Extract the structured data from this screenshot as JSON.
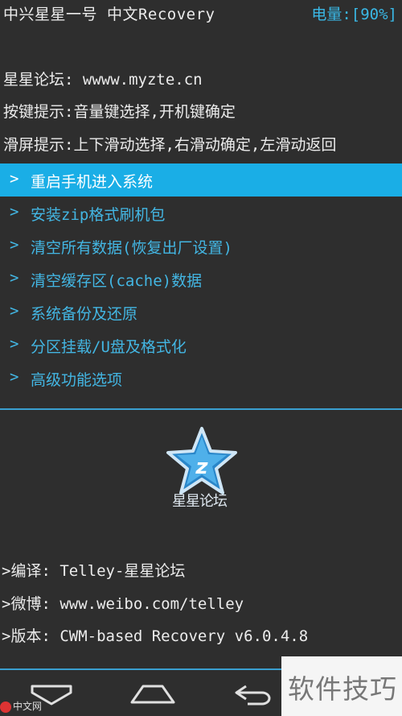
{
  "header": {
    "title": "中兴星星一号 中文Recovery",
    "battery": "电量:[90%]"
  },
  "info": {
    "forum": "星星论坛: wwww.myzte.cn",
    "key_hint": "按键提示:音量键选择,开机键确定",
    "swipe_hint": "滑屏提示:上下滑动选择,右滑动确定,左滑动返回"
  },
  "menu": {
    "arrow": ">",
    "items": [
      {
        "label": "重启手机进入系统",
        "selected": true
      },
      {
        "label": "安装zip格式刷机包",
        "selected": false
      },
      {
        "label": "清空所有数据(恢复出厂设置)",
        "selected": false
      },
      {
        "label": "清空缓存区(cache)数据",
        "selected": false
      },
      {
        "label": "系统备份及还原",
        "selected": false
      },
      {
        "label": "分区挂载/U盘及格式化",
        "selected": false
      },
      {
        "label": "高级功能选项",
        "selected": false
      }
    ]
  },
  "logo": {
    "icon": "star-z-logo-icon",
    "text": "星星论坛"
  },
  "about": {
    "compiler": ">编译: Telley-星星论坛",
    "weibo": ">微博: www.weibo.com/telley",
    "version": ">版本: CWM-based Recovery v6.0.4.8"
  },
  "navbar": {
    "icons": [
      "back-down-icon",
      "home-icon",
      "return-icon"
    ]
  },
  "watermark": {
    "text": "软件技巧",
    "small": "中文网"
  },
  "colors": {
    "background": "#2e2e2e",
    "accent": "#1aaee6",
    "menu_text": "#43b6e3",
    "divider": "#3a9fd0"
  }
}
